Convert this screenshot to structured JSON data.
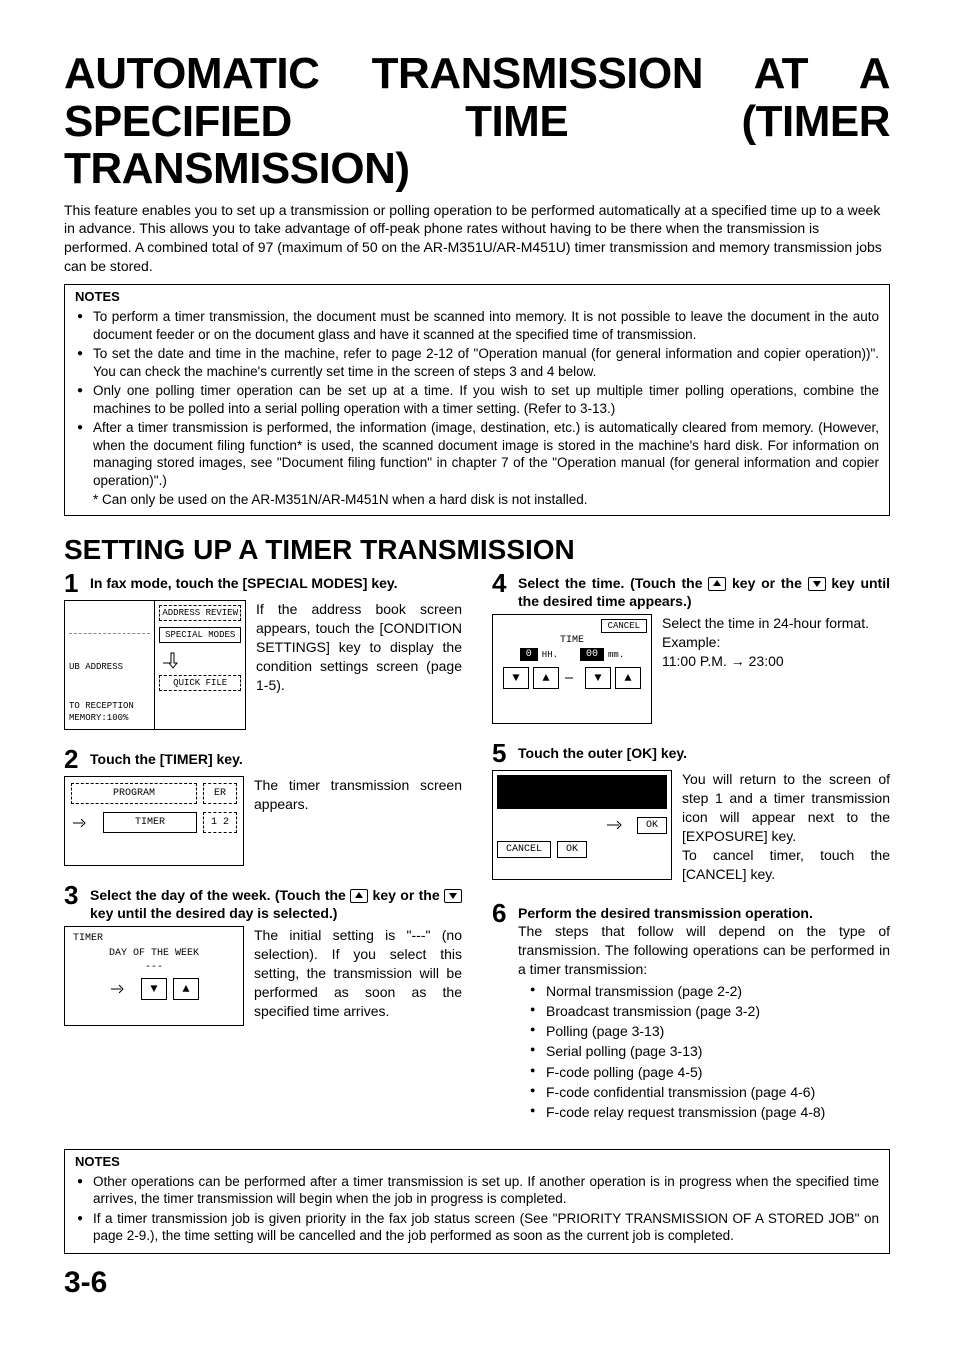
{
  "title_line1": "AUTOMATIC TRANSMISSION AT A",
  "title_line2": "SPECIFIED TIME (TIMER TRANSMISSION)",
  "intro": "This feature enables you to set up a transmission or polling operation to be performed automatically at a specified time up to a week in advance.  This allows you to take advantage of off-peak phone rates without having to be there when the transmission is performed. A combined total of 97 (maximum of 50 on the AR-M351U/AR-M451U) timer transmission and memory transmission jobs can be stored.",
  "notes1_title": "NOTES",
  "notes1": [
    "To perform a timer transmission, the document must be scanned into memory. It is not possible to leave the document in the auto document feeder or on the document glass and have it scanned at the specified time of transmission.",
    "To set the date and time in the machine, refer to page 2-12 of \"Operation manual (for general information and copier operation))\". You can check the machine's currently set time in the screen of steps 3 and 4 below.",
    "Only one polling timer operation can be set up at a time. If you wish to set up multiple timer polling operations, combine the machines to be polled into a serial polling operation with a timer setting. (Refer to 3-13.)",
    "After a timer transmission is performed, the information (image, destination, etc.) is automatically cleared from memory. (However, when the document filing function* is used, the scanned document image is stored in the machine's hard disk. For information on managing stored images, see \"Document filing function\" in chapter 7 of the \"Operation manual (for general information and copier operation)\".)"
  ],
  "notes1_footnote": "* Can only be used on the AR-M351N/AR-M451N when a hard disk is not installed.",
  "section_heading": "SETTING UP A TIMER TRANSMISSION",
  "steps": {
    "s1": {
      "num": "1",
      "title": "In fax mode, touch the [SPECIAL MODES] key.",
      "text": "If the address book screen appears, touch the [CONDITION SETTINGS] key to display the condition settings screen (page 1-5).",
      "lcd": {
        "left_top": "",
        "left_mid1": "UB ADDRESS",
        "left_mid2": "TO RECEPTION",
        "left_bot": "MEMORY:100%",
        "btn1": "ADDRESS REVIEW",
        "btn2": "SPECIAL MODES",
        "btn3": "QUICK FILE"
      }
    },
    "s2": {
      "num": "2",
      "title": "Touch the [TIMER] key.",
      "text": "The timer transmission screen appears.",
      "lcd": {
        "btn1": "PROGRAM",
        "btn2": "ER",
        "btn3": "TIMER",
        "btn4": "1 2"
      }
    },
    "s3": {
      "num": "3",
      "title_pre": "Select the day of the week. (Touch the ",
      "title_mid": " key or the ",
      "title_post": " key until the desired day is selected.)",
      "text": "The initial setting is \"---\" (no selection). If you select this setting, the transmission will be performed as soon as the specified time arrives.",
      "lcd": {
        "title": "TIMER",
        "sub": "DAY OF THE WEEK",
        "val": "---"
      }
    },
    "s4": {
      "num": "4",
      "title_pre": "Select the time. (Touch the ",
      "title_mid": " key or the ",
      "title_post": " key until the desired time appears.)",
      "text_l1": "Select the time in 24-hour format.",
      "text_l2": "Example:",
      "text_l3": "11:00 P.M. → 23:00",
      "lcd": {
        "cancel": "CANCEL",
        "label": "TIME",
        "hh": "0",
        "hh_lbl": "HH.",
        "mm": "00",
        "mm_lbl": "mm."
      }
    },
    "s5": {
      "num": "5",
      "title": "Touch the outer [OK] key.",
      "text": "You will return to the screen of step 1 and a timer transmission icon will appear next to the [EXPOSURE] key.\nTo cancel timer, touch the [CANCEL] key.",
      "lcd": {
        "ok": "OK",
        "cancel": "CANCEL"
      }
    },
    "s6": {
      "num": "6",
      "title": "Perform the desired transmission operation.",
      "text": "The steps that follow will depend on the type of transmission. The following operations can be performed in a timer transmission:",
      "items": [
        "Normal transmission (page 2-2)",
        "Broadcast transmission (page 3-2)",
        "Polling (page 3-13)",
        "Serial polling (page 3-13)",
        "F-code polling (page 4-5)",
        "F-code confidential transmission (page 4-6)",
        "F-code relay request transmission (page 4-8)"
      ]
    }
  },
  "notes2_title": "NOTES",
  "notes2": [
    "Other operations can be performed after a timer transmission is set up. If another operation is in progress when the specified time arrives, the timer transmission will begin when the job in progress is completed.",
    "If a timer transmission job is given priority in the fax job status screen (See \"PRIORITY TRANSMISSION OF A STORED JOB\" on page 2-9.), the time setting will be cancelled and the job performed as soon as the current job is completed."
  ],
  "page_number": "3-6"
}
